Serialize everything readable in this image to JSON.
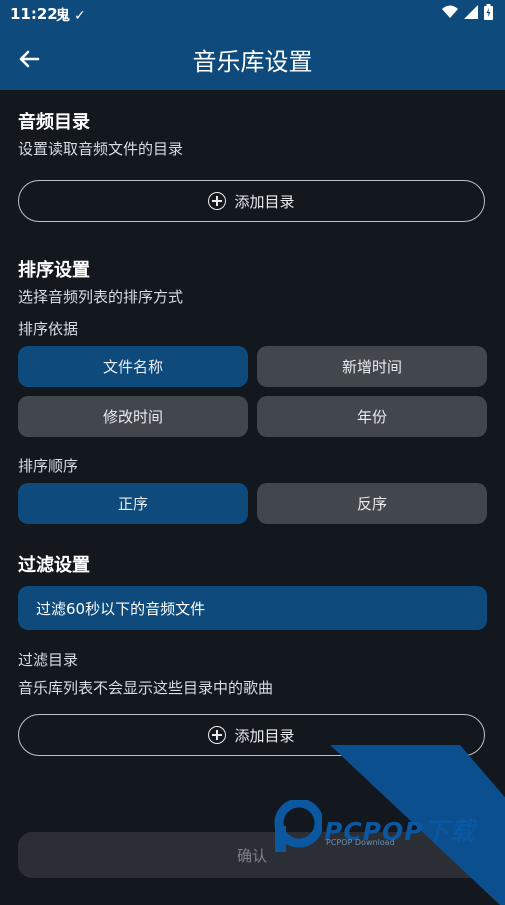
{
  "status_bar": {
    "time": "11:22",
    "left_icons": [
      "ghost-notification-icon",
      "check-notification-icon"
    ],
    "right_icons": [
      "wifi-icon",
      "signal-icon",
      "battery-icon"
    ]
  },
  "app_bar": {
    "title": "音乐库设置",
    "back_icon": "arrow-left-icon"
  },
  "audio_dir": {
    "heading": "音频目录",
    "description": "设置读取音频文件的目录",
    "add_button_label": "添加目录"
  },
  "sort": {
    "heading": "排序设置",
    "description": "选择音频列表的排序方式",
    "basis_label": "排序依据",
    "basis_options": [
      {
        "label": "文件名称",
        "selected": true
      },
      {
        "label": "新增时间",
        "selected": false
      },
      {
        "label": "修改时间",
        "selected": false
      },
      {
        "label": "年份",
        "selected": false
      }
    ],
    "order_label": "排序顺序",
    "order_options": [
      {
        "label": "正序",
        "selected": true
      },
      {
        "label": "反序",
        "selected": false
      }
    ]
  },
  "filter": {
    "heading": "过滤设置",
    "short_audio_option": "过滤60秒以下的音频文件",
    "dir_label": "过滤目录",
    "dir_description": "音乐库列表不会显示这些目录中的歌曲",
    "add_button_label": "添加目录"
  },
  "confirm_label": "确认",
  "watermark": {
    "brand": "PCPOP下载",
    "sub": "PCPOP Download"
  },
  "colors": {
    "accent": "#0e4a7b",
    "background": "#13171e",
    "chip_unselected": "#42464d"
  }
}
